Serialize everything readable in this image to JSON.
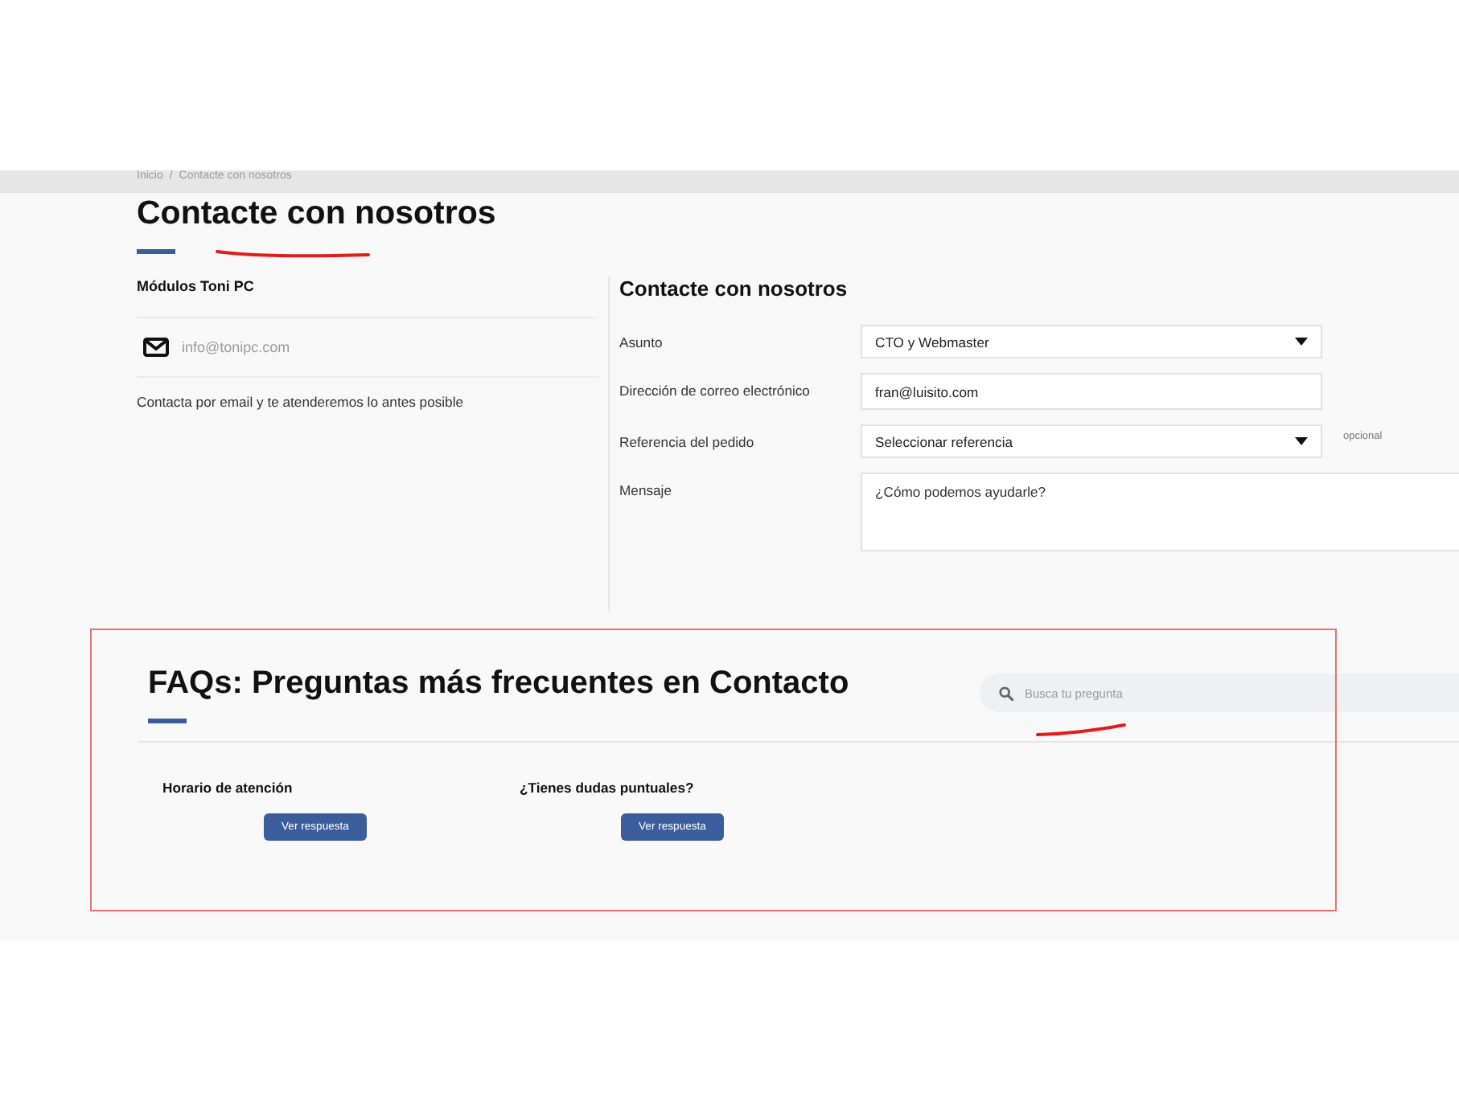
{
  "breadcrumb": {
    "items": [
      "Inicio",
      "Contacte con nosotros"
    ],
    "separator": "/"
  },
  "page_title": "Contacte con nosotros",
  "store": {
    "name": "Módulos Toni PC",
    "email": "info@tonipc.com",
    "note": "Contacta por email y te atenderemos lo antes posible"
  },
  "form": {
    "title": "Contacte con nosotros",
    "fields": [
      {
        "kind": "select",
        "label": "Asunto",
        "value": "CTO y Webmaster"
      },
      {
        "kind": "text",
        "label": "Dirección de correo electrónico",
        "value": "fran@luisito.com"
      },
      {
        "kind": "select",
        "label": "Referencia del pedido",
        "value": "Seleccionar referencia",
        "hint": "opcional"
      },
      {
        "kind": "textarea",
        "label": "Mensaje",
        "placeholder": "¿Cómo podemos ayudarle?"
      }
    ]
  },
  "faq": {
    "title": "FAQs: Preguntas más frecuentes en Contacto",
    "search": {
      "placeholder": "Busca tu pregunta"
    },
    "items": [
      {
        "question": "Horario de atención",
        "button": "Ver respuesta"
      },
      {
        "question": "¿Tienes dudas puntuales?",
        "button": "Ver respuesta"
      }
    ]
  }
}
